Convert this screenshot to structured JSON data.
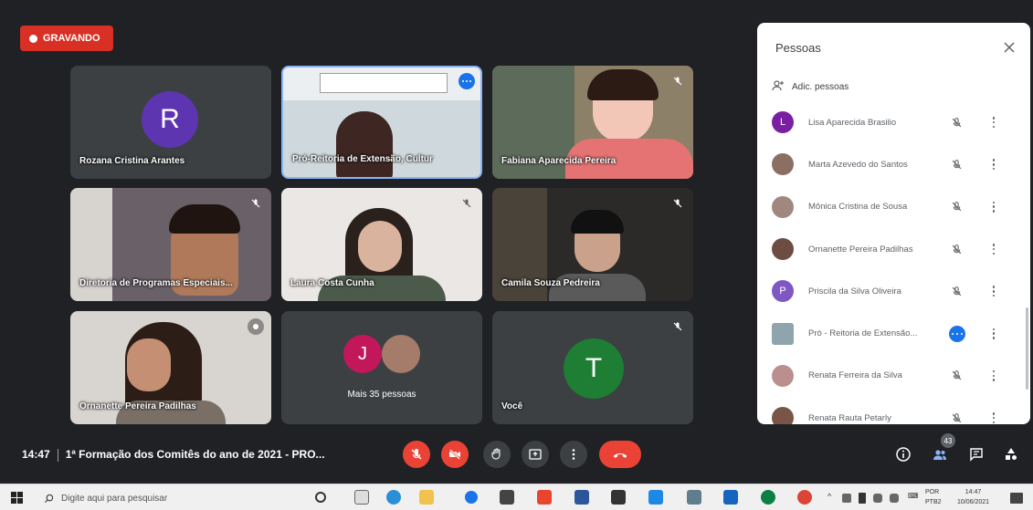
{
  "recording": {
    "label": "GRAVANDO",
    "color": "#d93025"
  },
  "tiles": [
    {
      "name": "Rozana Cristina Arantes",
      "avatar_letter": "R",
      "avatar_color": "#6a1b9a",
      "kind": "avatar"
    },
    {
      "name": "Pró-Reitoria de Extensão, Cultur",
      "kind": "video",
      "more_icon": "more-horiz-icon"
    },
    {
      "name": "Fabiana Aparecida Pereira",
      "kind": "video"
    },
    {
      "name": "Diretoria de Programas Especiais...",
      "kind": "video"
    },
    {
      "name": "Laura Costa Cunha",
      "kind": "video"
    },
    {
      "name": "Camila Souza Pedreira",
      "kind": "video"
    },
    {
      "name": "Ornanette Pereira Padilhas",
      "kind": "video"
    },
    {
      "name": "Mais 35 pessoas",
      "kind": "group",
      "avatar_letter": "J",
      "avatar_color": "#c2185b"
    },
    {
      "name": "Você",
      "avatar_letter": "T",
      "avatar_color": "#1e7e34",
      "kind": "avatar"
    }
  ],
  "meeting": {
    "time": "14:47",
    "title": "1ª Formação dos Comitês do ano de 2021 - PRO..."
  },
  "controls": {
    "participants_count": "43",
    "hangup_color": "#ea4335"
  },
  "people_panel": {
    "title": "Pessoas",
    "add_label": "Adic. pessoas",
    "people": [
      {
        "name": "Lisa Aparecida Brasilio",
        "avatar_letter": "L",
        "avatar_color": "#7b1fa2",
        "mic": "muted"
      },
      {
        "name": "Marta Azevedo do Santos",
        "avatar_letter": "",
        "avatar_color": "#8d6e63",
        "mic": "muted"
      },
      {
        "name": "Mônica Cristina de Sousa",
        "avatar_letter": "",
        "avatar_color": "#a1887f",
        "mic": "muted"
      },
      {
        "name": "Ornanette Pereira Padilhas",
        "avatar_letter": "",
        "avatar_color": "#6d4c41",
        "mic": "muted"
      },
      {
        "name": "Priscila da Silva Oliveira",
        "avatar_letter": "P",
        "avatar_color": "#7e57c2",
        "mic": "muted"
      },
      {
        "name": "Pró - Reitoria de Extensão...",
        "avatar_letter": "",
        "avatar_color": "#90a4ae",
        "mic": "active"
      },
      {
        "name": "Renata Ferreira da Silva",
        "avatar_letter": "",
        "avatar_color": "#bc8f8f",
        "mic": "muted"
      },
      {
        "name": "Renata Rauta Petarly",
        "avatar_letter": "",
        "avatar_color": "#795548",
        "mic": "muted"
      }
    ]
  },
  "taskbar": {
    "search_placeholder": "Digite aqui para pesquisar",
    "lang_top": "POR",
    "lang_bottom": "PTB2",
    "clock_time": "14:47",
    "clock_date": "10/06/2021"
  }
}
